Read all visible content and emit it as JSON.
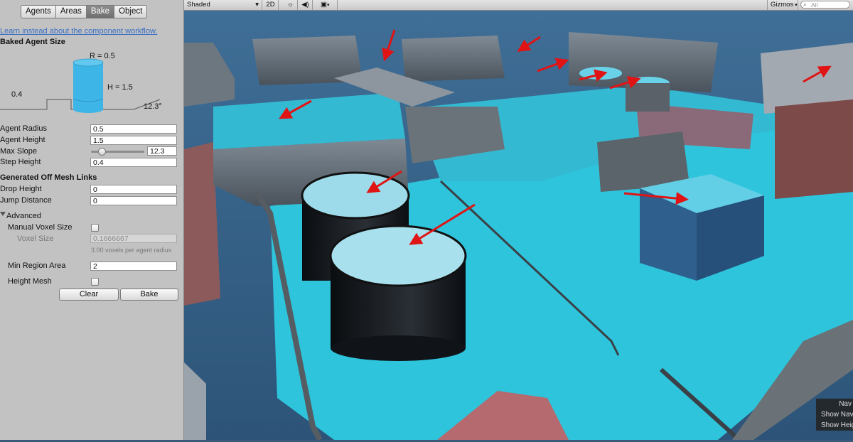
{
  "inspector": {
    "tabs": [
      {
        "label": "Agents",
        "active": false
      },
      {
        "label": "Areas",
        "active": false
      },
      {
        "label": "Bake",
        "active": true
      },
      {
        "label": "Object",
        "active": false
      }
    ],
    "workflow_link": "Learn instead about the component workflow.",
    "baked_agent_size": {
      "heading": "Baked Agent Size",
      "radius_label": "R = 0.5",
      "height_label": "H = 1.5",
      "step_label": "0.4",
      "slope_label": "12.3°"
    },
    "fields": {
      "agent_radius": {
        "label": "Agent Radius",
        "value": "0.5"
      },
      "agent_height": {
        "label": "Agent Height",
        "value": "1.5"
      },
      "max_slope": {
        "label": "Max Slope",
        "value": "12.3"
      },
      "step_height": {
        "label": "Step Height",
        "value": "0.4"
      }
    },
    "slider": {
      "min": 0,
      "max": 60,
      "value": 12.3
    },
    "off_mesh": {
      "heading": "Generated Off Mesh Links",
      "drop_height": {
        "label": "Drop Height",
        "value": "0"
      },
      "jump_distance": {
        "label": "Jump Distance",
        "value": "0"
      }
    },
    "advanced": {
      "heading": "Advanced",
      "manual_voxel_size": {
        "label": "Manual Voxel Size",
        "checked": false
      },
      "voxel_size": {
        "label": "Voxel Size",
        "value": "0.1666667"
      },
      "voxel_hint": "3.00 voxels per agent radius",
      "min_region_area": {
        "label": "Min Region Area",
        "value": "2"
      },
      "height_mesh": {
        "label": "Height Mesh",
        "checked": false
      }
    },
    "buttons": {
      "clear": "Clear",
      "bake": "Bake"
    },
    "cylinder_color": "#3db5e6"
  },
  "scene_toolbar": {
    "shading_mode": "Shaded",
    "mode_2d": "2D",
    "gizmos": "Gizmos",
    "search_placeholder": "All"
  },
  "scene": {
    "navmesh_color": "#2ec4dc",
    "arrow_color": "#e01414",
    "overlay": {
      "title": "Nav",
      "items": [
        "Show Nav",
        "Show Heig"
      ]
    }
  }
}
